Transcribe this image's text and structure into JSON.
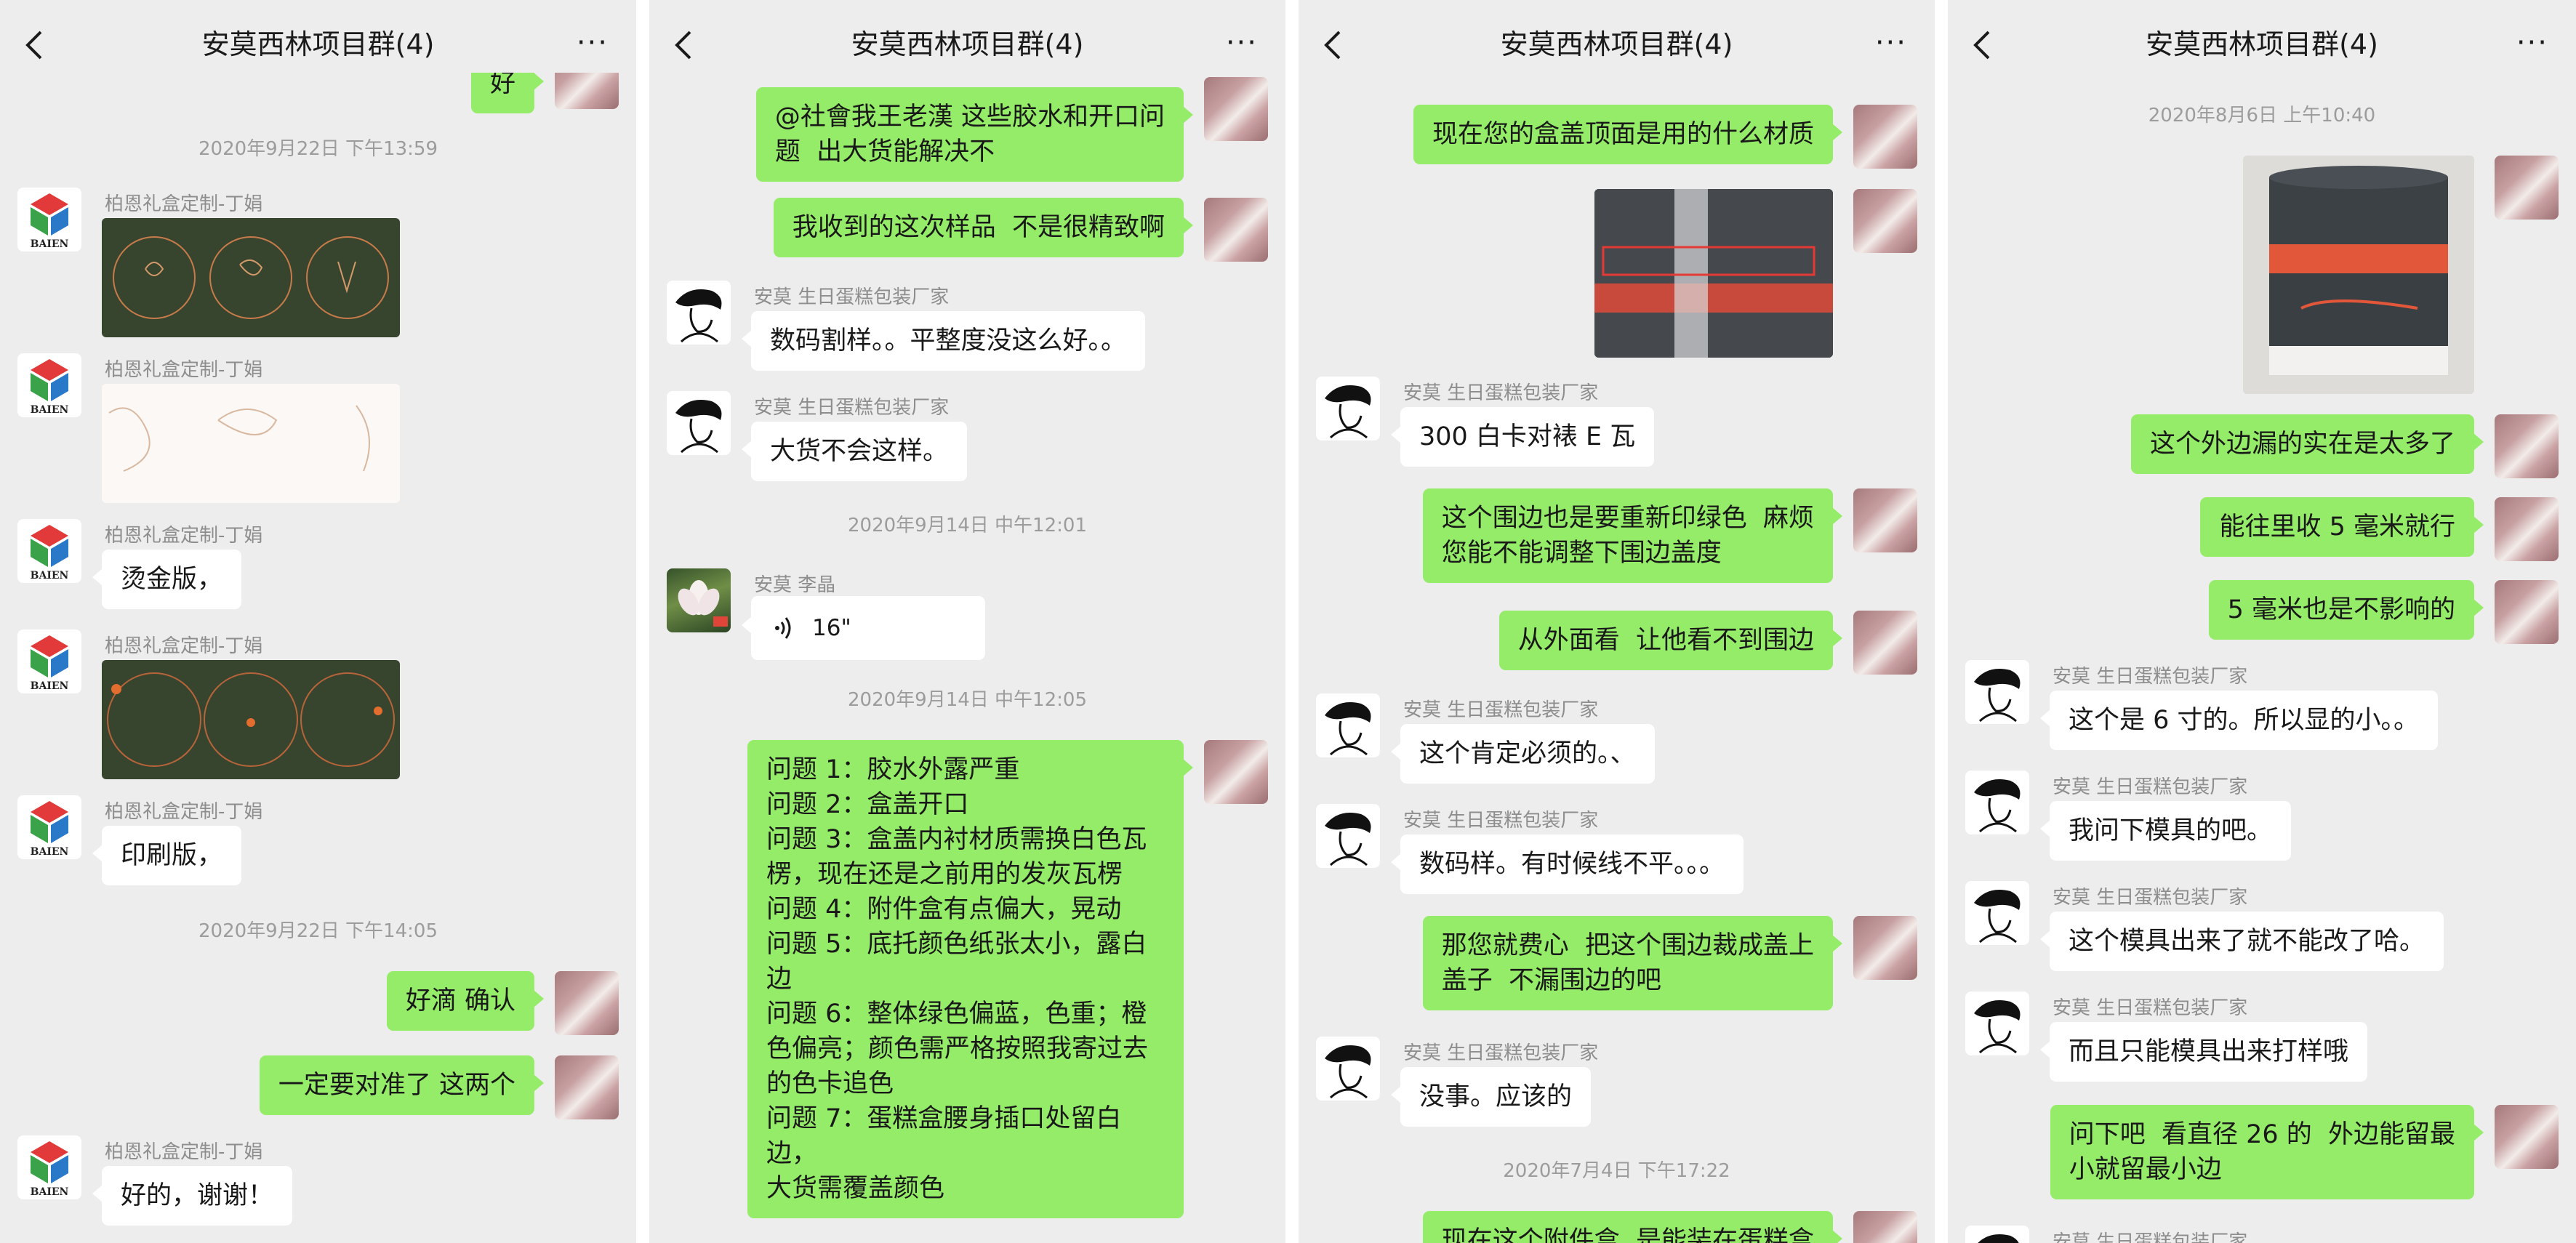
{
  "panels": [
    {
      "title": "安莫西林项目群(4)",
      "messages": [
        {
          "text": "好"
        },
        {
          "timestamp": "2020年9月22日 下午13:59"
        },
        {
          "sender": "柏恩礼盒定制-丁娟"
        },
        {
          "sender": "柏恩礼盒定制-丁娟"
        },
        {
          "sender": "柏恩礼盒定制-丁娟",
          "text": "烫金版，"
        },
        {
          "sender": "柏恩礼盒定制-丁娟"
        },
        {
          "sender": "柏恩礼盒定制-丁娟",
          "text": "印刷版，"
        },
        {
          "timestamp": "2020年9月22日 下午14:05"
        },
        {
          "text": "好滴 确认"
        },
        {
          "text": "一定要对准了 这两个"
        },
        {
          "sender": "柏恩礼盒定制-丁娟",
          "text": "好的，谢谢！"
        }
      ]
    },
    {
      "title": "安莫西林项目群(4)",
      "messages": [
        {
          "text": "@社會我王老漢 这些胶水和开口问\n题  出大货能解决不"
        },
        {
          "text": "我收到的这次样品  不是很精致啊"
        },
        {
          "sender": "安莫 生日蛋糕包装厂家",
          "text": "数码割样。。平整度没这么好。。"
        },
        {
          "sender": "安莫 生日蛋糕包装厂家",
          "text": "大货不会这样。"
        },
        {
          "timestamp": "2020年9月14日 中午12:01"
        },
        {
          "sender": "安莫 李晶",
          "voice": "16\""
        },
        {
          "timestamp": "2020年9月14日 中午12:05"
        },
        {
          "text": "问题 1：胶水外露严重\n问题 2：盒盖开口\n问题 3：盒盖内衬材质需换白色瓦\n楞，现在还是之前用的发灰瓦楞\n问题 4：附件盒有点偏大，晃动\n问题 5：底托颜色纸张太小，露白\n边\n问题 6：整体绿色偏蓝，色重；橙\n色偏亮；颜色需严格按照我寄过去\n的色卡追色\n问题 7：蛋糕盒腰身插口处留白边，\n大货需覆盖颜色"
        }
      ]
    },
    {
      "title": "安莫西林项目群(4)",
      "messages": [
        {
          "text": "现在您的盒盖顶面是用的什么材质"
        },
        {},
        {
          "sender": "安莫 生日蛋糕包装厂家",
          "text": "300 白卡对裱 E 瓦"
        },
        {
          "text": "这个围边也是要重新印绿色  麻烦\n您能不能调整下围边盖度"
        },
        {
          "text": "从外面看  让他看不到围边"
        },
        {
          "sender": "安莫 生日蛋糕包装厂家",
          "text": "这个肯定必须的。、"
        },
        {
          "sender": "安莫 生日蛋糕包装厂家",
          "text": "数码样。有时候线不平。。。"
        },
        {
          "text": "那您就费心  把这个围边裁成盖上\n盖子  不漏围边的吧"
        },
        {
          "sender": "安莫 生日蛋糕包装厂家",
          "text": "没事。应该的"
        },
        {
          "timestamp": "2020年7月4日 下午17:22"
        },
        {
          "text": "现在这个附件盒  是能装在蛋糕盒"
        }
      ]
    },
    {
      "title": "安莫西林项目群(4)",
      "messages": [
        {
          "timestamp": "2020年8月6日 上午10:40"
        },
        {},
        {
          "text": "这个外边漏的实在是太多了"
        },
        {
          "text": "能往里收 5 毫米就行"
        },
        {
          "text": "5 毫米也是不影响的"
        },
        {
          "sender": "安莫 生日蛋糕包装厂家",
          "text": "这个是 6 寸的。所以显的小。。"
        },
        {
          "sender": "安莫 生日蛋糕包装厂家",
          "text": "我问下模具的吧。"
        },
        {
          "sender": "安莫 生日蛋糕包装厂家",
          "text": "这个模具出来了就不能改了哈。"
        },
        {
          "sender": "安莫 生日蛋糕包装厂家",
          "text": "而且只能模具出来打样哦"
        },
        {
          "text": "问下吧  看直径 26 的  外边能留最\n小就留最小边"
        },
        {
          "sender": "安莫 生日蛋糕包装厂家"
        }
      ]
    }
  ]
}
